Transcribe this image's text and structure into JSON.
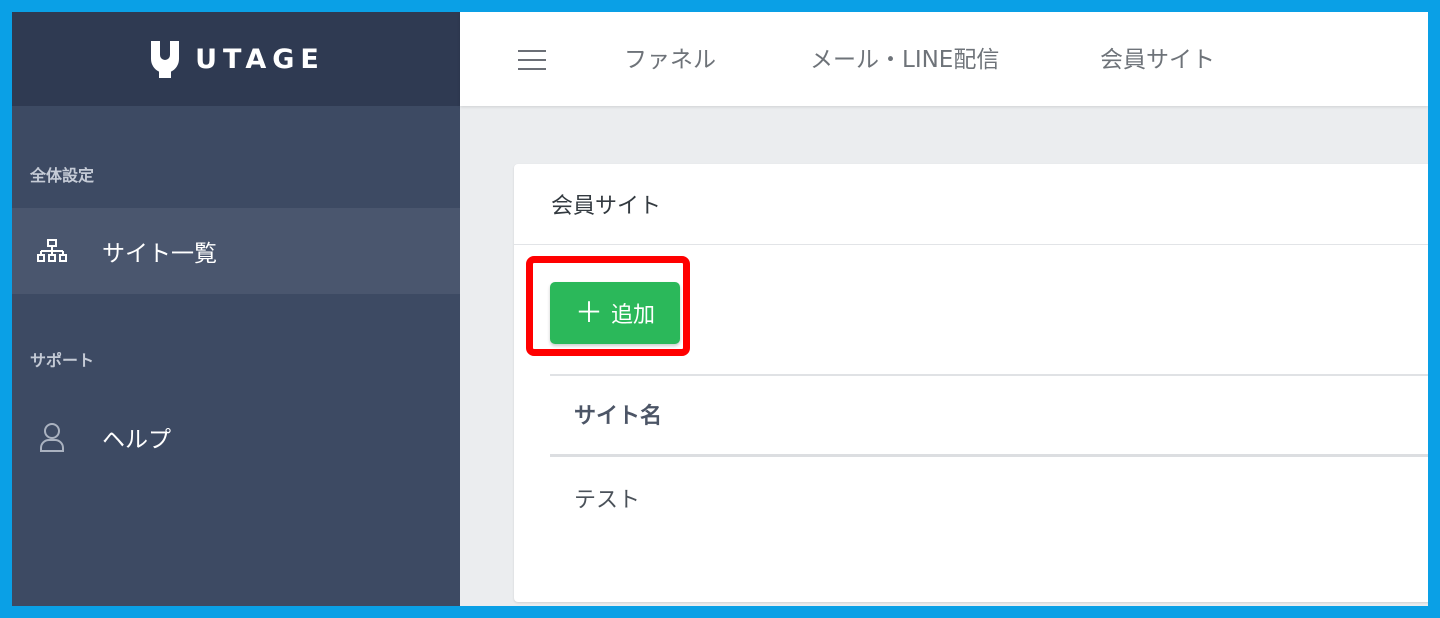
{
  "brand": {
    "logo_text": "UTAGE"
  },
  "sidebar": {
    "sections": [
      {
        "label": "全体設定",
        "items": [
          {
            "label": "サイト一覧",
            "icon": "sitemap-icon",
            "active": true
          }
        ]
      },
      {
        "label": "サポート",
        "items": [
          {
            "label": "ヘルプ",
            "icon": "user-icon",
            "active": false
          }
        ]
      }
    ]
  },
  "header": {
    "nav": [
      {
        "label": "ファネル"
      },
      {
        "label": "メール・LINE配信"
      },
      {
        "label": "会員サイト"
      }
    ]
  },
  "card": {
    "title": "会員サイト",
    "add_button": {
      "label": "追加",
      "icon": "plus-icon"
    },
    "table": {
      "columns": [
        "サイト名"
      ],
      "rows": [
        [
          "テスト"
        ]
      ]
    }
  },
  "colors": {
    "sidebar_bg": "#3d4a63",
    "logo_bar_bg": "#2f3a52",
    "add_button_bg": "#2bb85a",
    "highlight_border": "#ff0000",
    "outer_border": "#0aa0e6"
  }
}
